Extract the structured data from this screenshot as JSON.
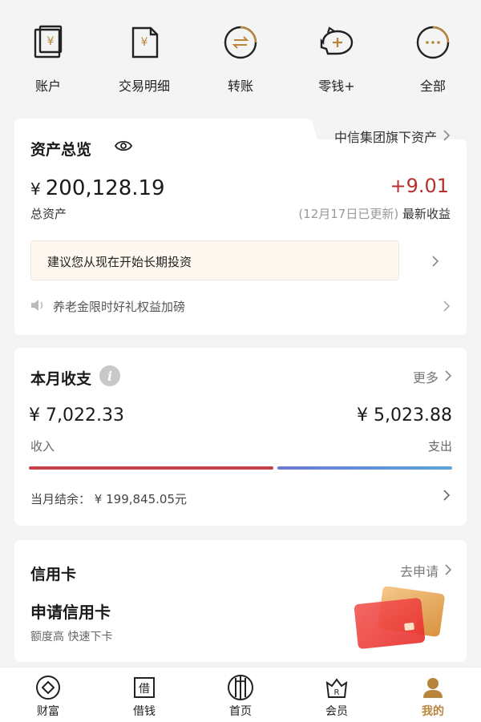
{
  "quick_actions": [
    {
      "label": "账户",
      "icon": "account-card-icon"
    },
    {
      "label": "交易明细",
      "icon": "transaction-detail-icon"
    },
    {
      "label": "转账",
      "icon": "transfer-icon"
    },
    {
      "label": "零钱+",
      "icon": "piggy-bank-icon"
    },
    {
      "label": "全部",
      "icon": "more-dots-icon"
    }
  ],
  "assets": {
    "title": "资产总览",
    "group_link": "中信集团旗下资产",
    "currency": "¥",
    "total_value": "200,128.19",
    "total_label": "总资产",
    "earnings": "+9.01",
    "updated_note": "(12月17日已更新)",
    "earnings_label": "最新收益",
    "suggestion": "建议您从现在开始长期投资",
    "notice": "养老金限时好礼权益加磅"
  },
  "monthly": {
    "title": "本月收支",
    "more": "更多",
    "income": "¥ 7,022.33",
    "income_label": "收入",
    "expense": "¥ 5,023.88",
    "expense_label": "支出",
    "balance_label": "当月结余：",
    "balance_value": "¥ 199,845.05元",
    "income_value": 7022.33,
    "expense_value": 5023.88
  },
  "credit": {
    "title": "信用卡",
    "apply": "去申请",
    "headline": "申请信用卡",
    "subtitle": "额度高 快速下卡"
  },
  "tabs": [
    {
      "label": "财富",
      "icon": "wealth-diamond-icon",
      "active": false
    },
    {
      "label": "借钱",
      "icon": "borrow-icon",
      "active": false
    },
    {
      "label": "首页",
      "icon": "home-gate-icon",
      "active": false
    },
    {
      "label": "会员",
      "icon": "member-crown-icon",
      "active": false
    },
    {
      "label": "我的",
      "icon": "profile-user-icon",
      "active": true
    }
  ],
  "colors": {
    "accent_gold": "#b8853c",
    "earnings_red": "#b5302f",
    "income_bar": "#c8404a",
    "expense_bar": "#5aa4e0"
  }
}
